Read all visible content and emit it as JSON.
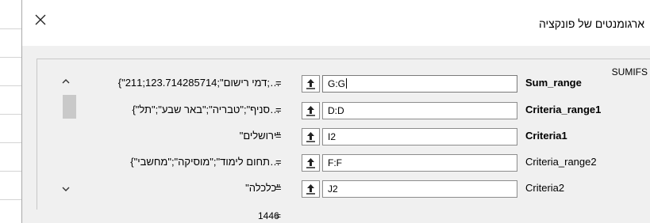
{
  "window": {
    "title": "ארגומנטים של פונקציה",
    "close_icon": "close-icon"
  },
  "function": {
    "name": "SUMIFS"
  },
  "arguments": [
    {
      "name": "Sum_range",
      "bold": true,
      "input": "G:G",
      "equals": "=",
      "value": "{\"דמי רישום\";123.714285714;211;…"
    },
    {
      "name": "Criteria_range1",
      "bold": true,
      "input": "D:D",
      "equals": "=",
      "value": "{\"סניף\";\"טבריה\";\"באר שבע\";\"תל…"
    },
    {
      "name": "Criteria1",
      "bold": true,
      "input": "I2",
      "equals": "=",
      "value": "\"ירושלים\""
    },
    {
      "name": "Criteria_range2",
      "bold": false,
      "input": "F:F",
      "equals": "=",
      "value": "{\"תחום לימוד\";\"מוסיקה\";\"מחשבי…"
    },
    {
      "name": "Criteria2",
      "bold": false,
      "input": "J2",
      "equals": "=",
      "value": "\"כלכלה\""
    }
  ],
  "result": {
    "value": "1446",
    "equals": "="
  },
  "icons": {
    "range_picker": "range-picker-icon",
    "scroll_up": "scroll-up-icon",
    "scroll_down": "scroll-down-icon"
  },
  "colors": {
    "dialog_bg": "#f0f0f0",
    "field_border": "#8c8c8c"
  }
}
